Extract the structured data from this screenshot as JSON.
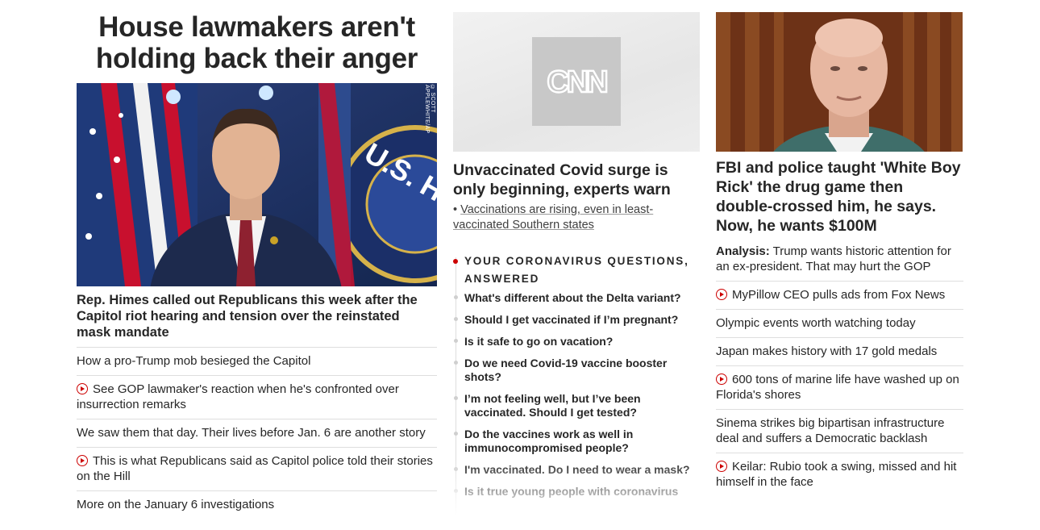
{
  "col1": {
    "headline": "House lawmakers aren't holding back their anger",
    "image_credit": "© SCOTT APPLEWHITE/AP",
    "card_title": "Rep. Himes called out Republicans this week after the Capitol riot hearing and tension over the reinstated mask mandate",
    "links": [
      {
        "text": "How a pro-Trump mob besieged the Capitol",
        "video": false
      },
      {
        "text": "See GOP lawmaker's reaction when he's confronted over insurrection remarks",
        "video": true
      },
      {
        "text": "We saw them that day. Their lives before Jan. 6 are another story",
        "video": false
      },
      {
        "text": "This is what Republicans said as Capitol police told their stories on the Hill",
        "video": true
      },
      {
        "text": "More on the January 6 investigations",
        "video": false
      }
    ]
  },
  "col2": {
    "logo_text": "CNN",
    "card_title": "Unvaccinated Covid surge is only beginning, experts warn",
    "sub_bullet": "Vaccinations are rising, even in least-vaccinated Southern states",
    "qa_title": "YOUR CORONAVIRUS QUESTIONS, ANSWERED",
    "questions": [
      "What's different about the Delta variant?",
      "Should I get vaccinated if I’m pregnant?",
      "Is it safe to go on vacation?",
      "Do we need Covid-19 vaccine booster shots?",
      "I’m not feeling well, but I’ve been vaccinated. Should I get tested?",
      "Do the vaccines work as well in immunocompromised people?",
      "I'm vaccinated. Do I need to wear a mask?",
      "Is it true young people with coronavirus"
    ]
  },
  "col3": {
    "card_title": "FBI and police taught 'White Boy Rick' the drug game then double-crossed him, he says. Now, he wants $100M",
    "analysis_label": "Analysis:",
    "analysis_text": "Trump wants historic attention for an ex-president. That may hurt the GOP",
    "links": [
      {
        "text": "MyPillow CEO pulls ads from Fox News",
        "video": true
      },
      {
        "text": "Olympic events worth watching today",
        "video": false
      },
      {
        "text": "Japan makes history with 17 gold medals",
        "video": false
      },
      {
        "text": "600 tons of marine life have washed up on Florida's shores",
        "video": true
      },
      {
        "text": "Sinema strikes big bipartisan infrastructure deal and suffers a Democratic backlash",
        "video": false
      },
      {
        "text": "Keilar: Rubio took a swing, missed and hit himself in the face",
        "video": true
      }
    ]
  },
  "colors": {
    "accent_red": "#cc0000",
    "text": "#262626",
    "divider": "#dedede"
  }
}
